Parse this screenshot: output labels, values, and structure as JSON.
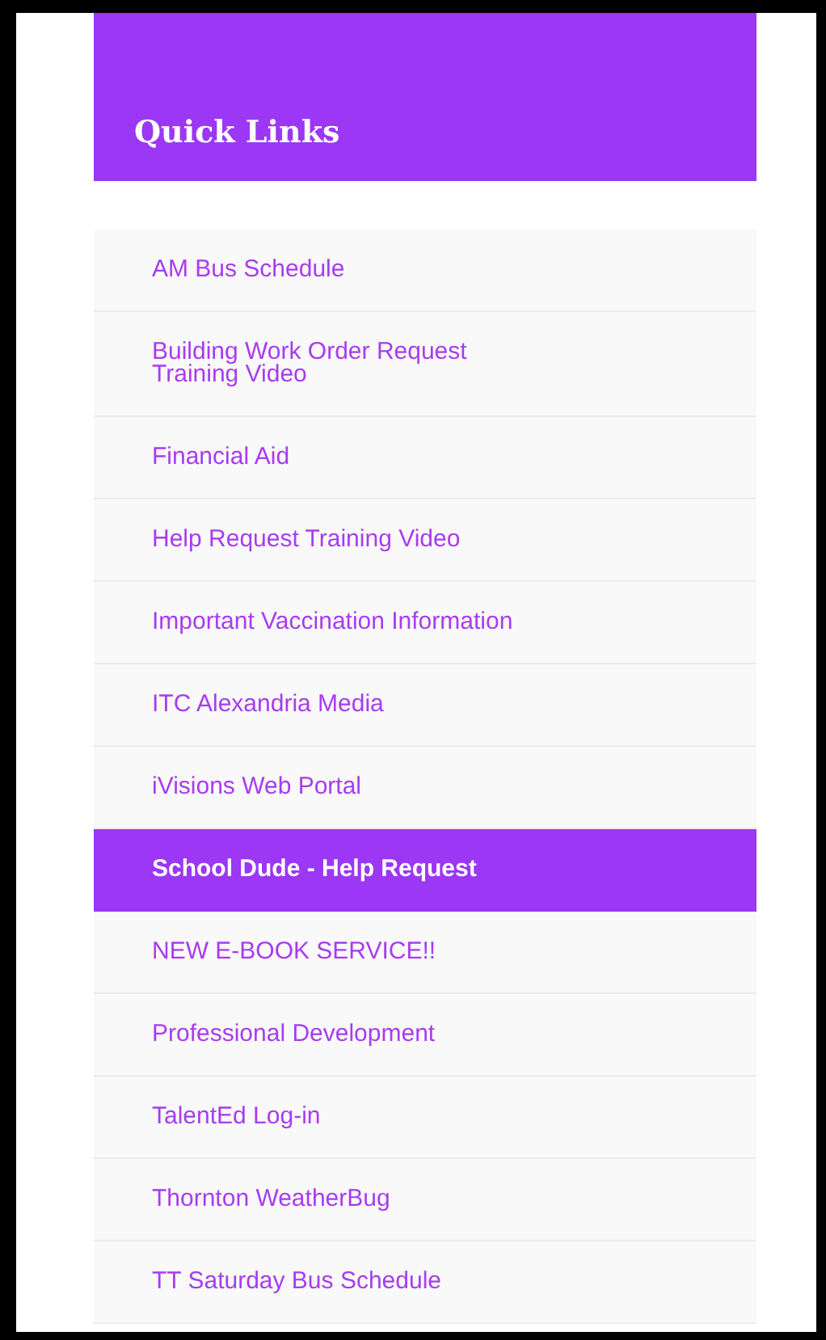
{
  "panel": {
    "title": "Quick Links",
    "links": [
      {
        "label": "AM Bus Schedule",
        "selected": false
      },
      {
        "label": "Building Work Order Request Training Video",
        "selected": false
      },
      {
        "label": "Financial Aid",
        "selected": false
      },
      {
        "label": "Help Request Training Video",
        "selected": false
      },
      {
        "label": "Important Vaccination Information",
        "selected": false
      },
      {
        "label": "ITC Alexandria Media",
        "selected": false
      },
      {
        "label": "iVisions Web Portal",
        "selected": false
      },
      {
        "label": "School Dude - Help Request",
        "selected": true
      },
      {
        "label": "NEW E-BOOK SERVICE!!",
        "selected": false
      },
      {
        "label": "Professional Development",
        "selected": false
      },
      {
        "label": "TalentEd Log-in",
        "selected": false
      },
      {
        "label": "Thornton WeatherBug",
        "selected": false
      },
      {
        "label": "TT Saturday Bus Schedule",
        "selected": false
      }
    ]
  }
}
